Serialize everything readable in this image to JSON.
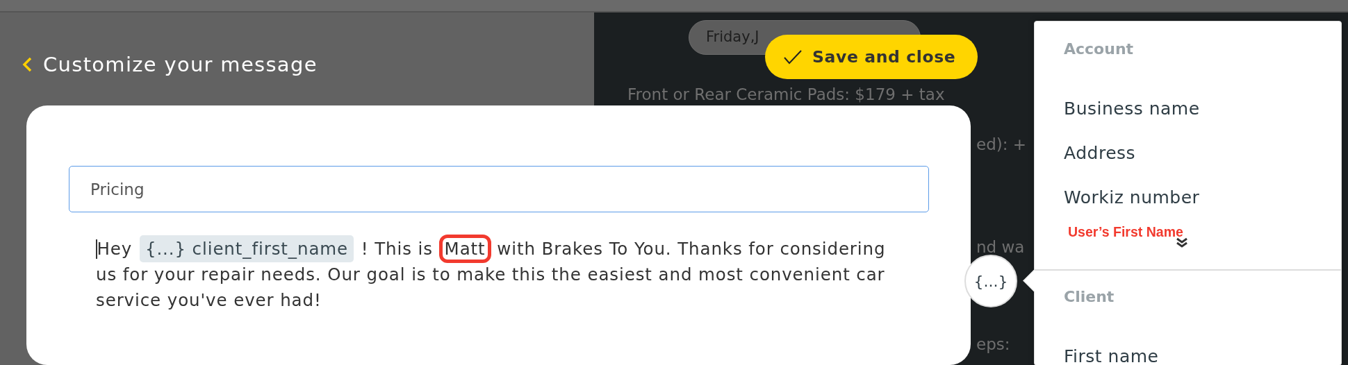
{
  "header": {
    "title": "Customize your message"
  },
  "preview": {
    "date": "Friday,J",
    "lines": [
      "Front or Rear Ceramic Pads: $179 + tax",
      "ed): +",
      "nd wa",
      "eps:"
    ]
  },
  "save_button": {
    "label": "Save and close"
  },
  "editor": {
    "title_field": {
      "value": "Pricing"
    },
    "message": [
      {
        "kind": "text",
        "text": "Hey "
      },
      {
        "kind": "variable",
        "text": "{...} client_first_name"
      },
      {
        "kind": "text",
        "text": " ! This is "
      },
      {
        "kind": "circled",
        "text": "Matt"
      },
      {
        "kind": "text",
        "text": " with Brakes To You. Thanks for considering us for your repair needs. Our goal is to make this the easiest and most convenient car service you've ever had!"
      }
    ]
  },
  "variables_button": {
    "label": "{...}"
  },
  "variables_menu": {
    "sections": [
      {
        "heading": "Account",
        "items": [
          "Business name",
          "Address",
          "Workiz number"
        ]
      },
      {
        "heading": "Client",
        "items": [
          "First name"
        ]
      }
    ]
  },
  "annotation": {
    "label": "User’s First Name",
    "color": "#f23a2e"
  }
}
